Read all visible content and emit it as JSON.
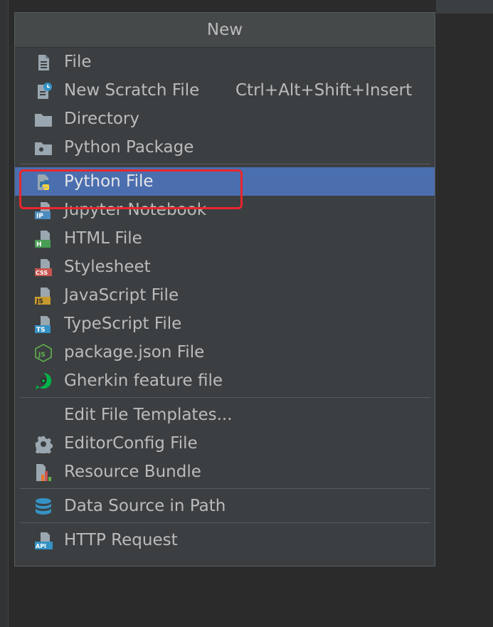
{
  "menu": {
    "title": "New",
    "items": [
      {
        "label": "File",
        "icon": "file-icon"
      },
      {
        "label": "New Scratch File",
        "shortcut": "Ctrl+Alt+Shift+Insert",
        "icon": "scratch-file-icon"
      },
      {
        "label": "Directory",
        "icon": "folder-icon"
      },
      {
        "label": "Python Package",
        "icon": "python-package-icon"
      },
      {
        "label": "Python File",
        "icon": "python-file-icon",
        "selected": true
      },
      {
        "label": "Jupyter Notebook",
        "icon": "jupyter-notebook-icon",
        "badge": "IP"
      },
      {
        "label": "HTML File",
        "icon": "html-file-icon",
        "badge": "H"
      },
      {
        "label": "Stylesheet",
        "icon": "css-file-icon",
        "badge": "CSS"
      },
      {
        "label": "JavaScript File",
        "icon": "javascript-file-icon",
        "badge": "JS"
      },
      {
        "label": "TypeScript File",
        "icon": "typescript-file-icon",
        "badge": "TS"
      },
      {
        "label": "package.json File",
        "icon": "nodejs-icon",
        "badge": "JS"
      },
      {
        "label": "Gherkin feature file",
        "icon": "gherkin-icon"
      },
      {
        "label": "Edit File Templates...",
        "icon": ""
      },
      {
        "label": "EditorConfig File",
        "icon": "gear-icon"
      },
      {
        "label": "Resource Bundle",
        "icon": "resource-bundle-icon"
      },
      {
        "label": "Data Source in Path",
        "icon": "database-icon"
      },
      {
        "label": "HTTP Request",
        "icon": "http-request-icon",
        "badge": "API"
      }
    ]
  },
  "colors": {
    "background": "#2b2b2b",
    "menu_bg": "#3c3f41",
    "selection": "#4b6eaf",
    "annotation": "#e8262c"
  }
}
